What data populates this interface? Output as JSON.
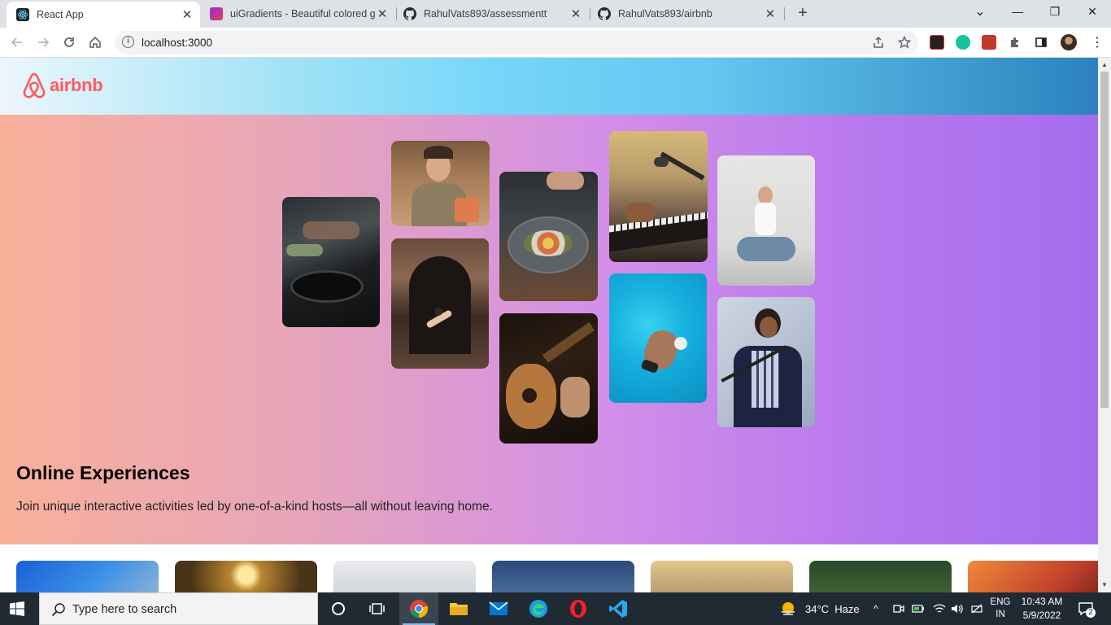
{
  "browser": {
    "tabs": [
      {
        "title": "React App",
        "active": true
      },
      {
        "title": "uiGradients - Beautiful colored g",
        "active": false
      },
      {
        "title": "RahulVats893/assessmentt",
        "active": false
      },
      {
        "title": "RahulVats893/airbnb",
        "active": false
      }
    ],
    "url": "localhost:3000",
    "new_tab": "+",
    "window_controls": {
      "dropdown": "⌄",
      "minimize": "—",
      "restore": "❐",
      "close": "✕"
    }
  },
  "navbar": {
    "logo_text": "airbnb"
  },
  "hero": {
    "title": "Online Experiences",
    "subtitle": "Join unique interactive activities led by one-of-a-kind hosts—all without leaving home.",
    "photos": [
      "cooking-pans",
      "woman-pottery",
      "dancer-doorway",
      "bowl-food",
      "acoustic-guitar",
      "microphone-keyboard",
      "swimmer-pool",
      "yoga-woman",
      "singer-mic"
    ]
  },
  "taskbar": {
    "search_placeholder": "Type here to search",
    "weather": "34°C  Haze",
    "lang_top": "ENG",
    "lang_bottom": "IN",
    "time": "10:43 AM",
    "date": "5/9/2022",
    "notification_count": "2"
  },
  "colors": {
    "airbnb_red": "#ff5a5f",
    "taskbar": "#202a33",
    "tab_strip": "#dee1e6"
  }
}
